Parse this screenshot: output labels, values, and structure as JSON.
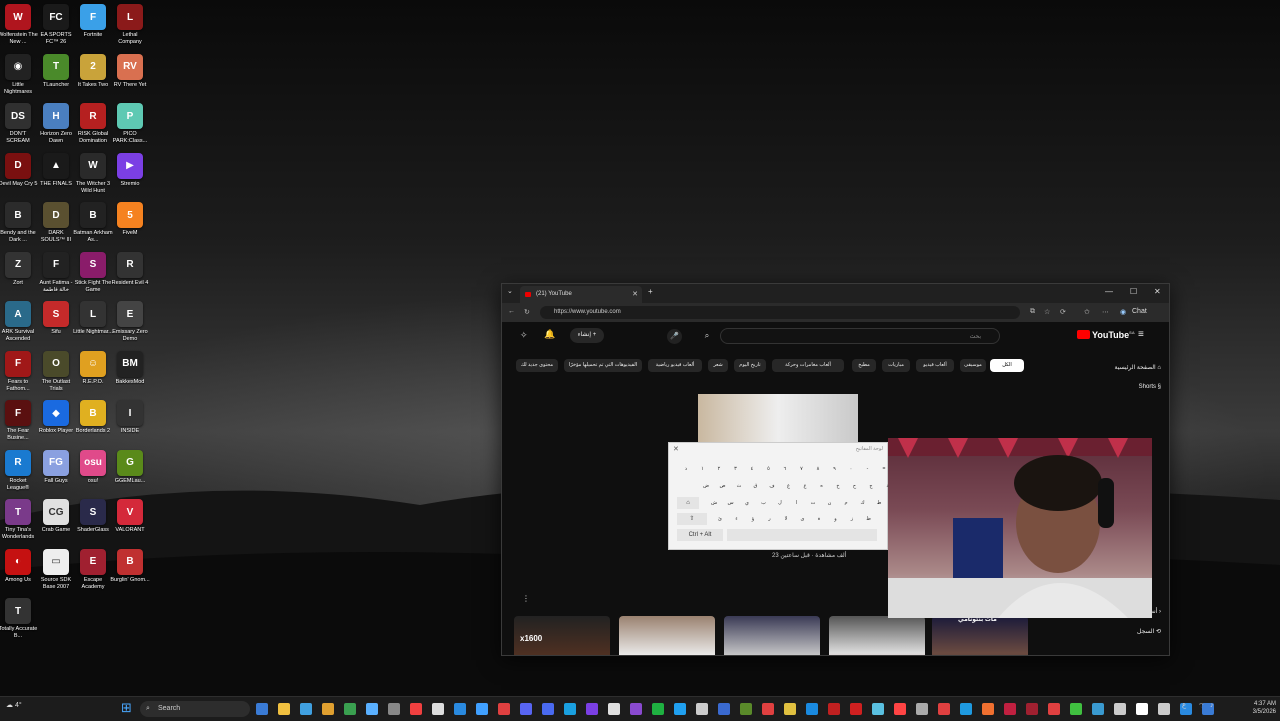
{
  "desktop": {
    "icons": [
      {
        "label": "Wolfenstein The New ...",
        "color": "#b0151e",
        "glyph": "W"
      },
      {
        "label": "EA SPORTS FC™ 26",
        "color": "#1a1a1a",
        "glyph": "FC"
      },
      {
        "label": "Fortnite",
        "color": "#3aa0e8",
        "glyph": "F"
      },
      {
        "label": "Lethal Company",
        "color": "#8b1a1a",
        "glyph": "L"
      },
      {
        "label": "Little Nightmares",
        "color": "#222",
        "glyph": "◉"
      },
      {
        "label": "TLauncher",
        "color": "#4a8a2a",
        "glyph": "T"
      },
      {
        "label": "It Takes Two",
        "color": "#c9a33a",
        "glyph": "2"
      },
      {
        "label": "RV There Yet",
        "color": "#d97050",
        "glyph": "RV"
      },
      {
        "label": "DON'T SCREAM",
        "color": "#303030",
        "glyph": "DS"
      },
      {
        "label": "Horizon Zero Dawn",
        "color": "#4a7fc0",
        "glyph": "H"
      },
      {
        "label": "RISK Global Domination",
        "color": "#b52020",
        "glyph": "R"
      },
      {
        "label": "PICO PARK:Class...",
        "color": "#5ec9b3",
        "glyph": "P"
      },
      {
        "label": "Devil May Cry 5",
        "color": "#7a1010",
        "glyph": "D"
      },
      {
        "label": "THE FINALS",
        "color": "#1a1a1a",
        "glyph": "▲"
      },
      {
        "label": "The Witcher 3 Wild Hunt",
        "color": "#2a2a2a",
        "glyph": "W"
      },
      {
        "label": "Stremio",
        "color": "#7b3fe4",
        "glyph": "▶"
      },
      {
        "label": "Bendy and the Dark ...",
        "color": "#2b2b2b",
        "glyph": "B"
      },
      {
        "label": "DARK SOULS™ III",
        "color": "#5a5030",
        "glyph": "D"
      },
      {
        "label": "Batman Arkham As...",
        "color": "#222",
        "glyph": "B"
      },
      {
        "label": "FiveM",
        "color": "#f58220",
        "glyph": "5"
      },
      {
        "label": "Zort",
        "color": "#333",
        "glyph": "Z"
      },
      {
        "label": "Aunt Fatima - خالة فاطمة",
        "color": "#222",
        "glyph": "F"
      },
      {
        "label": "Stick Fight The Game",
        "color": "#8a1c6a",
        "glyph": "S"
      },
      {
        "label": "Resident Evil 4",
        "color": "#333",
        "glyph": "R"
      },
      {
        "label": "ARK Survival Ascended",
        "color": "#2a6a8a",
        "glyph": "A"
      },
      {
        "label": "Sifu",
        "color": "#c42a2a",
        "glyph": "S"
      },
      {
        "label": "Little Nightmar...",
        "color": "#333",
        "glyph": "L"
      },
      {
        "label": "Emissary Zero Demo",
        "color": "#444",
        "glyph": "E"
      },
      {
        "label": "Fears to Fathom...",
        "color": "#a01818",
        "glyph": "F"
      },
      {
        "label": "The Outlast Trials",
        "color": "#4a4a2a",
        "glyph": "O"
      },
      {
        "label": "R.E.P.O.",
        "color": "#e0a020",
        "glyph": "☺"
      },
      {
        "label": "BakkesMod",
        "color": "#222",
        "glyph": "BM"
      },
      {
        "label": "The Fear Busine...",
        "color": "#5a1010",
        "glyph": "F"
      },
      {
        "label": "Roblox Player",
        "color": "#1a6ae0",
        "glyph": "◆"
      },
      {
        "label": "Borderlands 2",
        "color": "#e0b020",
        "glyph": "B"
      },
      {
        "label": "INSIDE",
        "color": "#333",
        "glyph": "I"
      },
      {
        "label": "Rocket League®",
        "color": "#1a7ad0",
        "glyph": "R"
      },
      {
        "label": "Fall Guys",
        "color": "#8aa0e0",
        "glyph": "FG"
      },
      {
        "label": "osu!",
        "color": "#e04a8a",
        "glyph": "osu"
      },
      {
        "label": "GGEMLau...",
        "color": "#5a8a1a",
        "glyph": "G"
      },
      {
        "label": "Tiny Tina's Wonderlands",
        "color": "#7a3a8a",
        "glyph": "T"
      },
      {
        "label": "Crab Game",
        "color": "#e0e0e0",
        "glyph": "CG"
      },
      {
        "label": "ShaderGlass",
        "color": "#2a2a4a",
        "glyph": "S"
      },
      {
        "label": "VALORANT",
        "color": "#d4293a",
        "glyph": "V"
      },
      {
        "label": "Among Us",
        "color": "#c51111",
        "glyph": "◐"
      },
      {
        "label": "Source SDK Base 2007",
        "color": "#eee",
        "glyph": "▭"
      },
      {
        "label": "Escape Academy",
        "color": "#a02030",
        "glyph": "E"
      },
      {
        "label": "Burglin' Gnom...",
        "color": "#c03030",
        "glyph": "B"
      },
      {
        "label": "Totally Accurate B...",
        "color": "#333",
        "glyph": "T"
      }
    ]
  },
  "browser": {
    "tab_title": "(21) YouTube",
    "new_tab": "+",
    "url": "https://www.youtube.com",
    "chat_label": "Chat"
  },
  "youtube": {
    "logo": "YouTube",
    "logo_sup": "SA",
    "create_label": "إنشاء",
    "search_placeholder": "بحث",
    "chips": [
      "الكل",
      "موسيقى",
      "ألعاب فيديو",
      "مباريات",
      "مطبخ",
      "ألعاب مغامرات وحركة",
      "تاريخ اليوم",
      "شعر",
      "ألعاب فيديو رياضية",
      "الفيديوهات التي تم تحميلها مؤخرًا",
      "محتوى جديد لك"
    ],
    "sidebar": {
      "home": "الصفحة الرئيسية",
      "shorts": "Shorts",
      "you": "أنت",
      "history": "السجل"
    },
    "video_meta": "23 ألف مشاهدة · قبل ساعتين",
    "card_badge": "x1600",
    "card_label": "مات بنتونامي"
  },
  "osk": {
    "title": "لوحة المفاتيح",
    "rows": [
      [
        "ذ",
        "١",
        "٢",
        "٣",
        "٤",
        "٥",
        "٦",
        "٧",
        "٨",
        "٩",
        "٠",
        "-",
        "="
      ],
      [
        "ض",
        "ص",
        "ث",
        "ق",
        "ف",
        "غ",
        "ع",
        "ه",
        "خ",
        "ح",
        "ج",
        "د"
      ],
      [
        "ش",
        "س",
        "ي",
        "ب",
        "ل",
        "ا",
        "ت",
        "ن",
        "م",
        "ك",
        "ط"
      ],
      [
        "ئ",
        "ء",
        "ؤ",
        "ر",
        "لا",
        "ى",
        "ة",
        "و",
        "ز",
        "ظ"
      ]
    ],
    "ctrl_alt": "Ctrl + Alt"
  },
  "taskbar": {
    "search_label": "Search",
    "weather": "4°",
    "time": "4:37 AM",
    "date": "3/5/2026",
    "lang": "ع"
  },
  "colors": {
    "yt_red": "#ff0000",
    "taskbar": "#1c1c1c"
  }
}
